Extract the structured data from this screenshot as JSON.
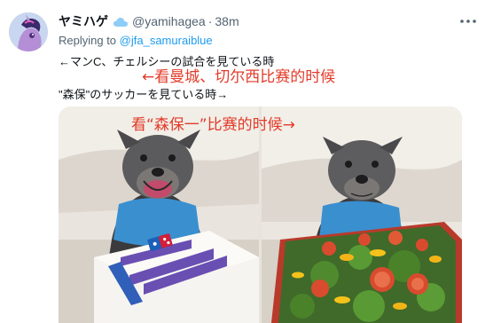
{
  "tweet": {
    "display_name": "ヤミハゲ",
    "handle": "@yamihagea",
    "separator": "·",
    "time": "38m",
    "replying_prefix": "Replying to",
    "replying_handle": "@jfa_samuraiblue",
    "line1": "←マンC、チェルシーの試合を見ている時",
    "line2": "\"森保\"のサッカーを見ている時→"
  },
  "annotations": {
    "top": "←看曼城、切尔西比赛的时候",
    "media": "看“森保一”比赛的时候→"
  },
  "media": {
    "left_image": "dog-with-domino-pizza-box",
    "right_image": "dog-with-salad-in-pizza-box"
  },
  "icons": {
    "avatar": "pony-avatar",
    "verified": "cloud-badge-icon",
    "more": "more-icon"
  },
  "colors": {
    "link": "#1d9bf0",
    "annotation": "#e23b2a",
    "secondary_text": "#536471"
  }
}
